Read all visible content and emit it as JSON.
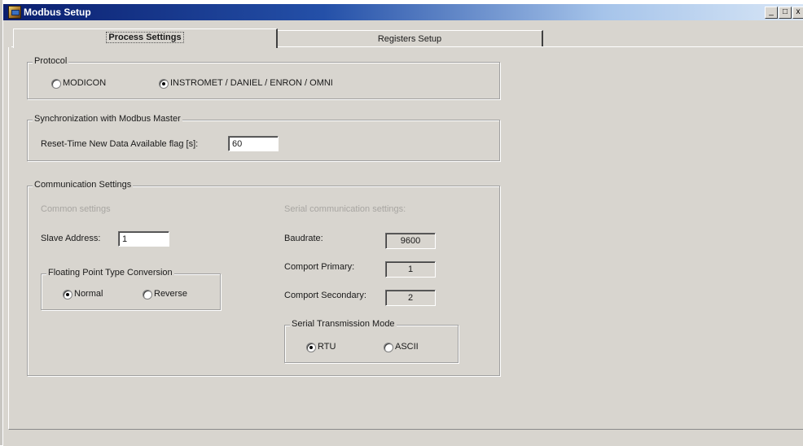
{
  "window": {
    "title": "Modbus Setup",
    "minimize_glyph": "_",
    "maximize_glyph": "□",
    "close_glyph": "x"
  },
  "tabs": [
    {
      "label": "Process Settings",
      "active": true
    },
    {
      "label": "Registers Setup",
      "active": false
    }
  ],
  "protocol": {
    "legend": "Protocol",
    "options": [
      {
        "label": "MODICON",
        "selected": false
      },
      {
        "label": "INSTROMET / DANIEL / ENRON / OMNI",
        "selected": true
      }
    ]
  },
  "sync": {
    "legend": "Synchronization with Modbus Master",
    "reset_label": "Reset-Time New Data Available flag [s]:",
    "reset_value": "60"
  },
  "comm": {
    "legend": "Communication Settings",
    "common_heading": "Common settings",
    "slave_label": "Slave Address:",
    "slave_value": "1",
    "floating": {
      "legend": "Floating Point Type Conversion",
      "options": [
        {
          "label": "Normal",
          "selected": true
        },
        {
          "label": "Reverse",
          "selected": false
        }
      ]
    },
    "serial_heading": "Serial communication settings:",
    "baudrate_label": "Baudrate:",
    "baudrate_value": "9600",
    "comport_primary_label": "Comport Primary:",
    "comport_primary_value": "1",
    "comport_secondary_label": "Comport Secondary:",
    "comport_secondary_value": "2",
    "serial_mode": {
      "legend": "Serial Transmission Mode",
      "options": [
        {
          "label": "RTU",
          "selected": true
        },
        {
          "label": "ASCII",
          "selected": false
        }
      ]
    }
  },
  "colors": {
    "face": "#d8d5cf",
    "title_start": "#0a1e6e",
    "title_end": "#d8e6f6",
    "disabled_text": "#a8a6a2"
  }
}
